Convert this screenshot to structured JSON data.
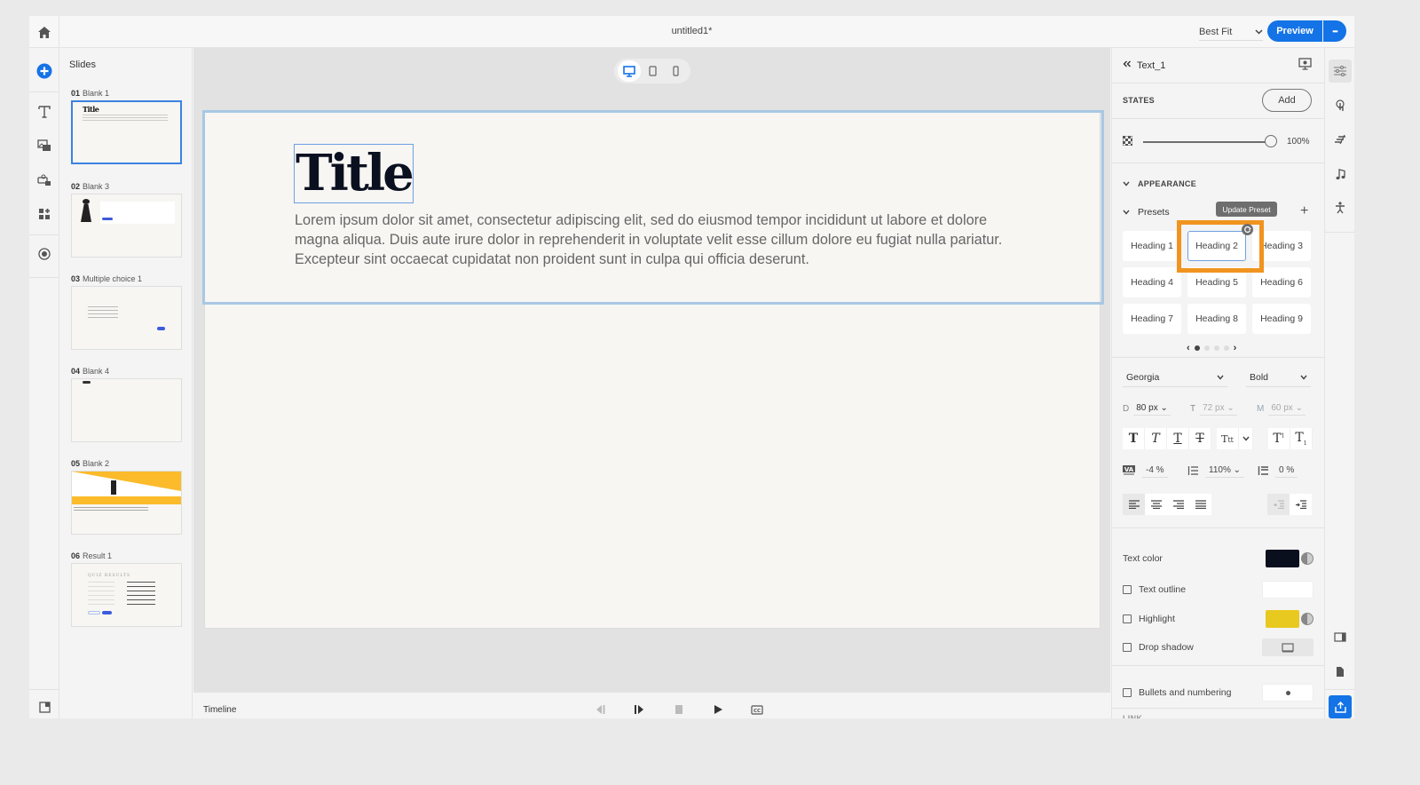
{
  "topbar": {
    "doc_title": "untitled1*",
    "zoom_select": "Best Fit",
    "preview_label": "Preview",
    "more_label": "•••"
  },
  "slides_panel": {
    "heading": "Slides",
    "slides": [
      {
        "num": "01",
        "name": "Blank 1",
        "thumb_title": "Title",
        "active": true
      },
      {
        "num": "02",
        "name": "Blank 3"
      },
      {
        "num": "03",
        "name": "Multiple choice 1"
      },
      {
        "num": "04",
        "name": "Blank 4"
      },
      {
        "num": "05",
        "name": "Blank 2"
      },
      {
        "num": "06",
        "name": "Result 1",
        "thumb_title": "QUIZ RESULTS"
      }
    ]
  },
  "canvas": {
    "title": "Title",
    "body": "Lorem ipsum dolor sit amet, consectetur adipiscing elit, sed do eiusmod tempor incididunt ut labore et dolore magna aliqua. Duis aute irure dolor in reprehenderit in voluptate velit esse cillum dolore eu fugiat nulla pariatur. Excepteur sint occaecat cupidatat non proident sunt in culpa qui officia deserunt.",
    "active_device": "desktop"
  },
  "timeline": {
    "label": "Timeline"
  },
  "properties": {
    "component_name": "Text_1",
    "states_label": "STATES",
    "add_label": "Add",
    "opacity": "100%",
    "opacity_fraction": 1.0,
    "appearance_label": "APPEARANCE",
    "presets_label": "Presets",
    "tooltip": "Update Preset",
    "presets": [
      "Heading 1",
      "Heading 2",
      "Heading 3",
      "Heading 4",
      "Heading 5",
      "Heading 6",
      "Heading 7",
      "Heading 8",
      "Heading 9"
    ],
    "selected_preset": "Heading 2",
    "preset_page": 1,
    "preset_pages": 4,
    "font_family": "Georgia",
    "font_weight": "Bold",
    "size_desktop_prefix": "D",
    "size_desktop": "80 px",
    "size_tablet_prefix": "T",
    "size_tablet": "72 px",
    "size_mobile_prefix": "M",
    "size_mobile": "60 px",
    "letter_spacing": "-4 %",
    "line_height": "110%",
    "paragraph_spacing": "0 %",
    "text_color_label": "Text color",
    "text_color": "#0a0f1e",
    "text_outline_label": "Text outline",
    "highlight_label": "Highlight",
    "highlight_color": "#e8c91f",
    "drop_shadow_label": "Drop shadow",
    "bullets_label": "Bullets and numbering",
    "link_label": "LINK"
  },
  "colors": {
    "accent": "#1473e6",
    "highlight_box": "#f0941f"
  }
}
